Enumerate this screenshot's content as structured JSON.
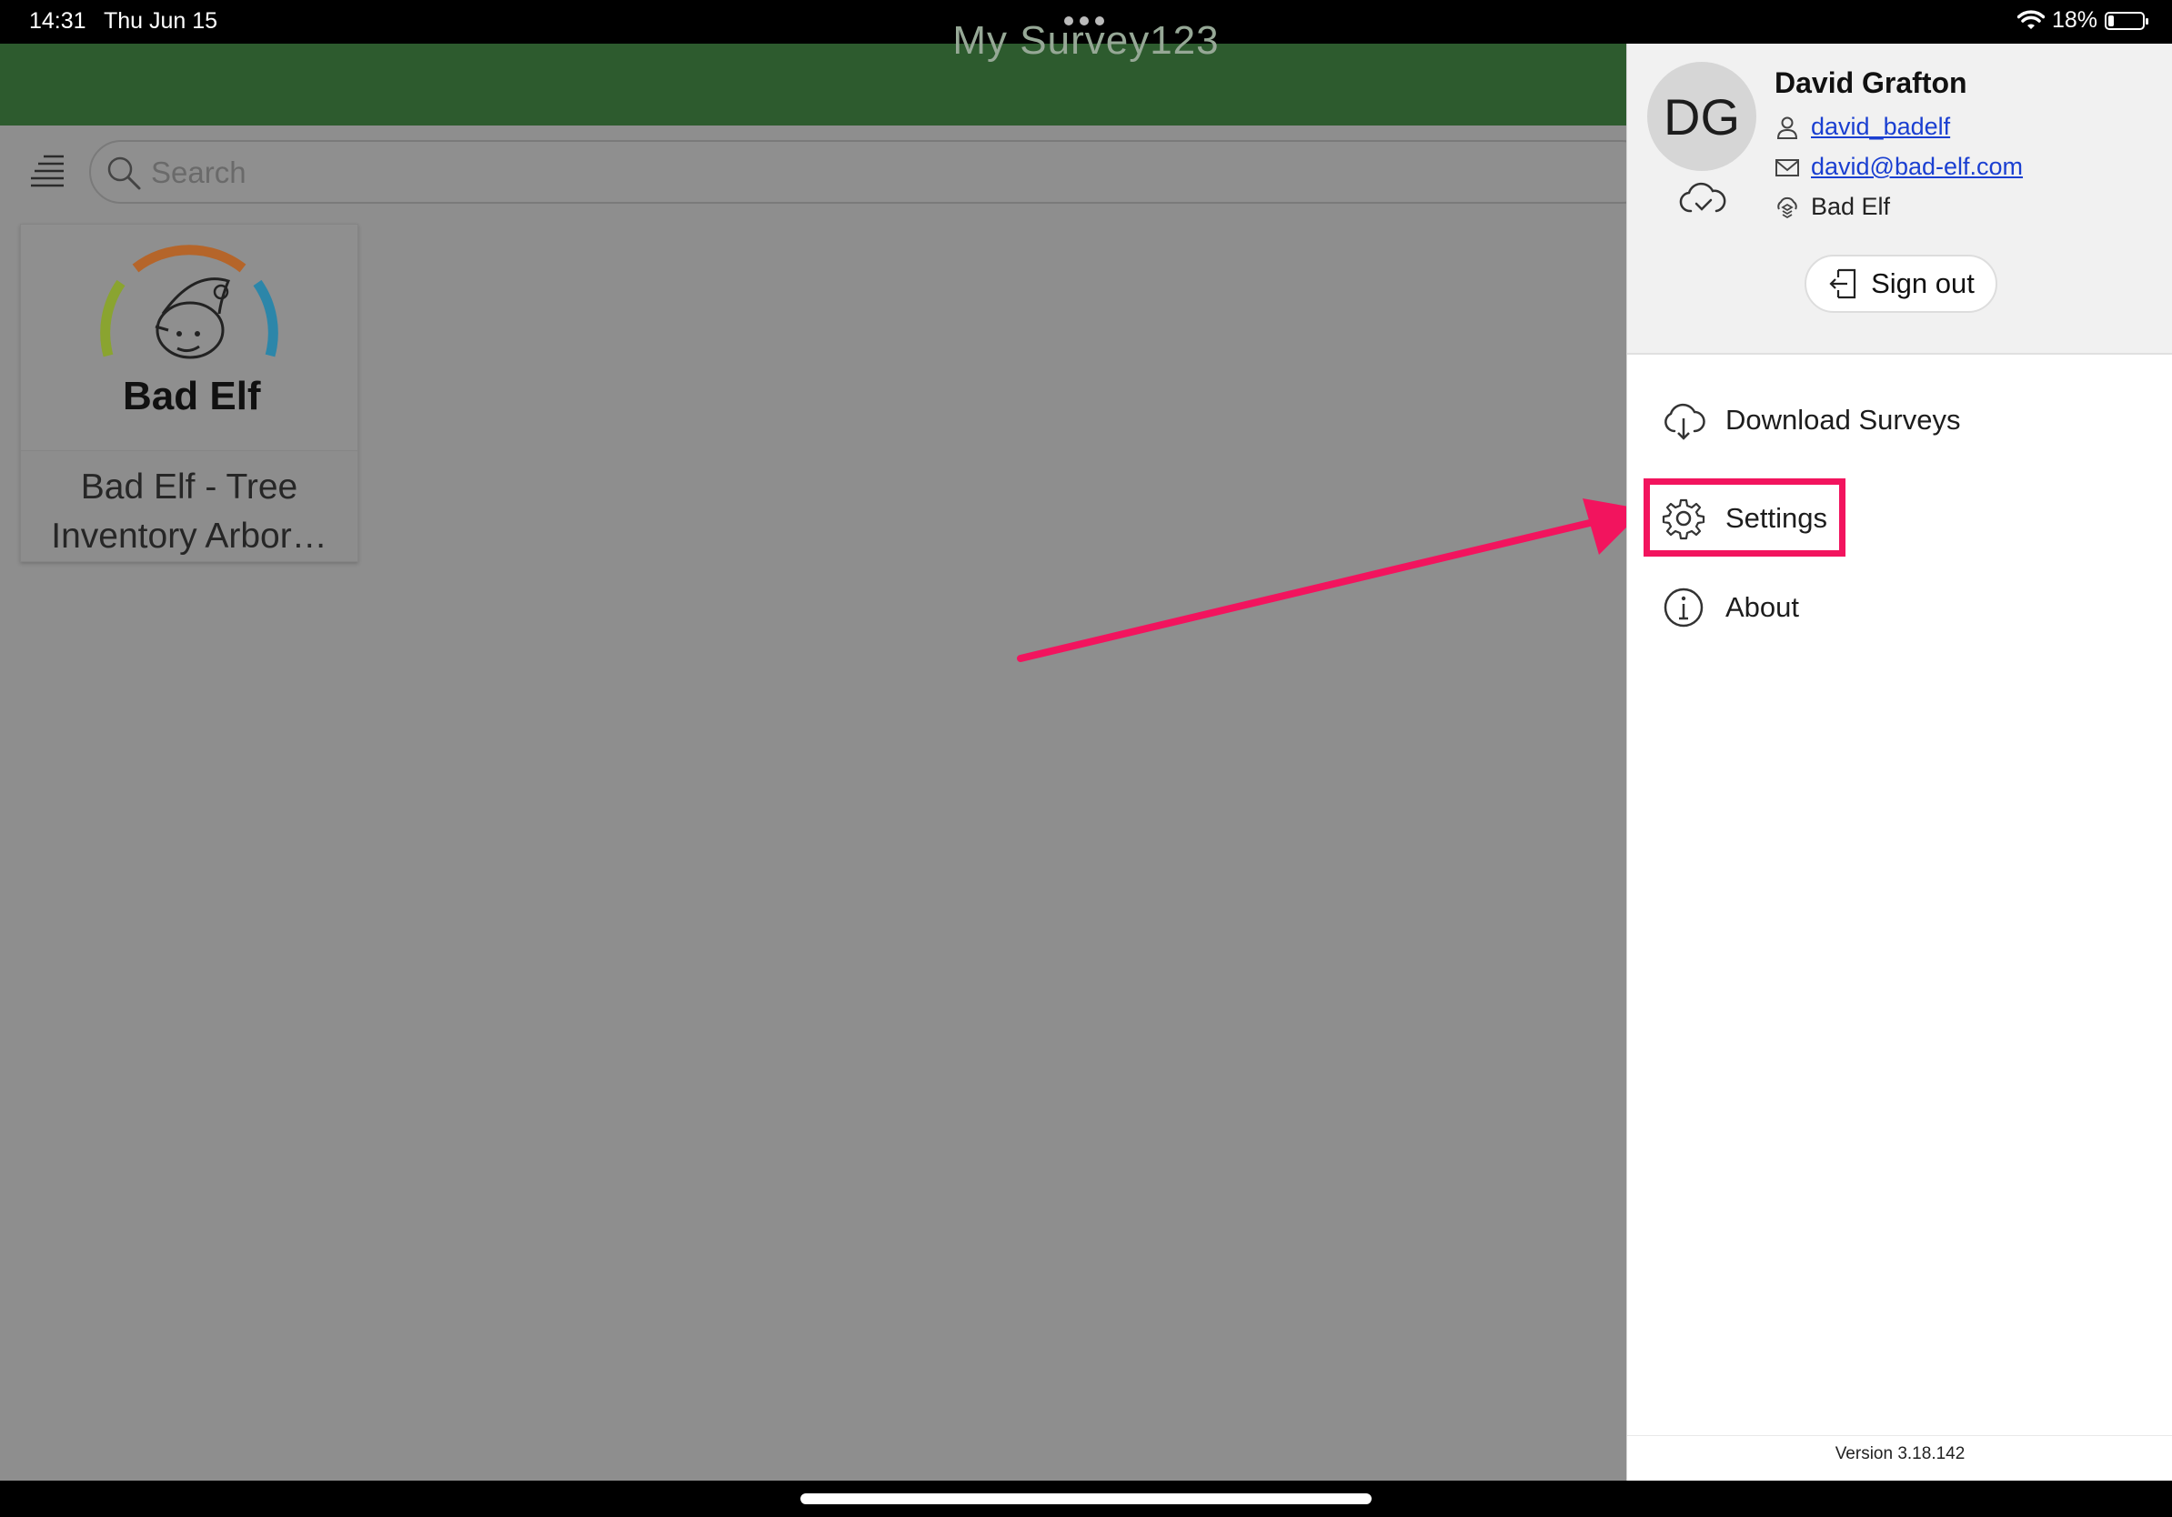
{
  "status_bar": {
    "time": "14:31",
    "date": "Thu Jun 15",
    "battery_text": "18%",
    "battery_level": 0.18
  },
  "app": {
    "title": "My Survey123",
    "search_placeholder": "Search",
    "surveys": [
      {
        "logo_text": "Bad Elf",
        "title_line1": "Bad Elf - Tree",
        "title_line2": "Inventory Arbor…"
      }
    ]
  },
  "drawer": {
    "avatar_initials": "DG",
    "user_name": "David Grafton",
    "username": "david_badelf",
    "email": "david@bad-elf.com",
    "organization": "Bad Elf",
    "sign_out_label": "Sign out",
    "menu": [
      {
        "label": "Download Surveys",
        "icon": "cloud-download-icon"
      },
      {
        "label": "Settings",
        "icon": "gear-icon"
      },
      {
        "label": "About",
        "icon": "info-icon"
      }
    ],
    "version": "Version 3.18.142"
  },
  "colors": {
    "appbar": "#2d5b2e",
    "highlight": "#f2145e",
    "link": "#1a3fd1",
    "dim_background": "#8e8e8e"
  }
}
